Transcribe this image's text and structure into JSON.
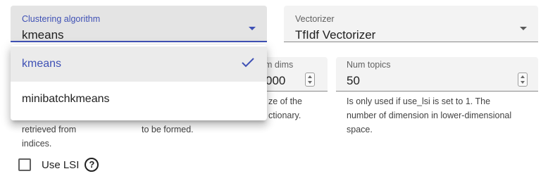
{
  "cluster_select": {
    "label": "Clustering algorithm",
    "value": "kmeans",
    "options": [
      "kmeans",
      "minibatchkmeans"
    ],
    "selected": "kmeans"
  },
  "vectorizer_select": {
    "label": "Vectorizer",
    "value": "TfIdf Vectorizer"
  },
  "num_dims": {
    "label": "um dims",
    "value": "000",
    "help_lines": [
      "ze of the",
      "ctionary."
    ]
  },
  "num_topics": {
    "label": "Num topics",
    "value": "50",
    "help_lines": [
      "Is only used if use_lsi is set to 1. The",
      "number of dimension in lower-dimensional",
      "space."
    ]
  },
  "partial_help": {
    "col1_lines": [
      "retrieved from",
      "indices."
    ],
    "col2_lines": [
      "to be formed."
    ]
  },
  "use_lsi": {
    "label": "Use LSI",
    "checked": false,
    "help_icon": "?"
  },
  "colors": {
    "accent": "#3f51b5",
    "field_bg": "#f3f3f3",
    "active_field_bg": "#e4e4e4"
  },
  "icons": {
    "dropdown_arrow": "triangle-down",
    "selected_mark": "checkmark",
    "help": "question-circle"
  }
}
